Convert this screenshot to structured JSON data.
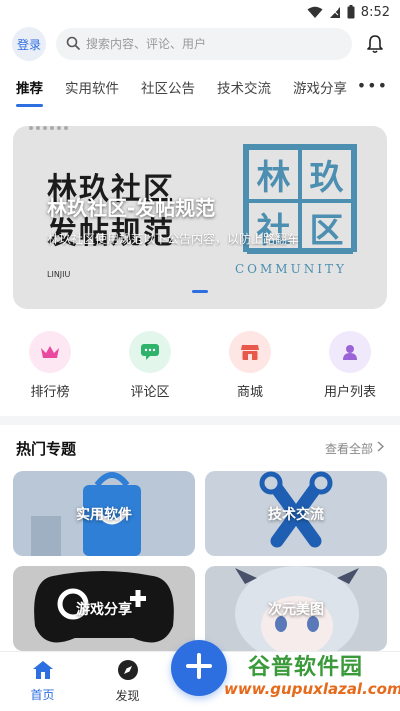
{
  "status": {
    "time": "8:52"
  },
  "header": {
    "login_label": "登录",
    "search_placeholder": "搜索内容、评论、用户"
  },
  "tabs": [
    {
      "label": "推荐"
    },
    {
      "label": "实用软件"
    },
    {
      "label": "社区公告"
    },
    {
      "label": "技术交流"
    },
    {
      "label": "游戏分享"
    }
  ],
  "tabs_more": "•••",
  "banner": {
    "big_text_line1": "林玖社区",
    "big_text_line2": "发帖规范",
    "logo_chars": [
      "林",
      "玖",
      "社",
      "区"
    ],
    "logo_caption": "COMMUNITY",
    "small_caption": "LINJIU",
    "title": "林玖社区-发帖规范",
    "subtitle": "林玖社区使用规范以下公告内容，以防上路翻车"
  },
  "quick_links": [
    {
      "label": "排行榜",
      "icon": "crown-icon",
      "bg": "#fde7f2",
      "color": "#e94aa0"
    },
    {
      "label": "评论区",
      "icon": "comment-icon",
      "bg": "#e3f6ec",
      "color": "#2fb26a"
    },
    {
      "label": "商城",
      "icon": "shop-icon",
      "bg": "#fde6e4",
      "color": "#e8594b"
    },
    {
      "label": "用户列表",
      "icon": "user-icon",
      "bg": "#f0e8fb",
      "color": "#9a63d8"
    }
  ],
  "topics": {
    "title": "热门专题",
    "see_all": "查看全部",
    "cards": [
      {
        "label": "实用软件",
        "bg": "#b9c7d6"
      },
      {
        "label": "技术交流",
        "bg": "#c9d2dc"
      },
      {
        "label": "游戏分享",
        "bg": "#c8c8c8"
      },
      {
        "label": "次元美图",
        "bg": "#c9cfd7"
      }
    ]
  },
  "bottom_nav": {
    "home_label": "首页",
    "discover_label": "发现"
  },
  "watermark": {
    "text": "谷普软件园",
    "url": "www.gupuxlazal.com"
  }
}
